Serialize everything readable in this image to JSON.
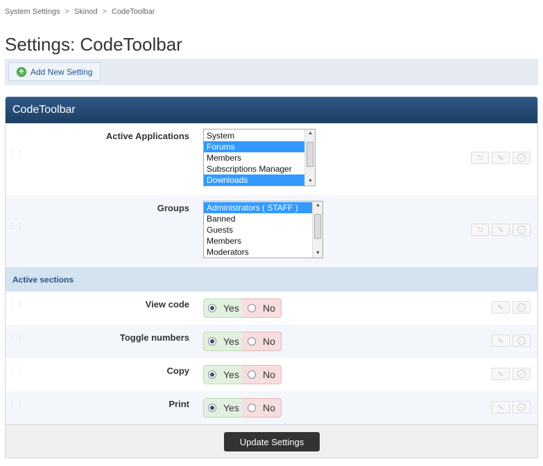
{
  "breadcrumb": {
    "items": [
      "System Settings",
      "Skinod",
      "CodeToolbar"
    ],
    "separator": ">"
  },
  "page": {
    "title": "Settings: CodeToolbar"
  },
  "toolbar": {
    "add_label": "Add New Setting"
  },
  "panel": {
    "title": "CodeToolbar",
    "active_applications": {
      "label": "Active Applications",
      "options": [
        "System",
        "Forums",
        "Members",
        "Subscriptions Manager",
        "Downloads"
      ],
      "selected": [
        "Forums",
        "Downloads"
      ]
    },
    "groups": {
      "label": "Groups",
      "options": [
        "Administrators ( STAFF )",
        "Banned",
        "Guests",
        "Members",
        "Moderators"
      ],
      "selected": [
        "Administrators ( STAFF )"
      ]
    },
    "section_title": "Active sections",
    "toggles": [
      {
        "label": "View code",
        "yes": "Yes",
        "no": "No",
        "value": "Yes"
      },
      {
        "label": "Toggle numbers",
        "yes": "Yes",
        "no": "No",
        "value": "Yes"
      },
      {
        "label": "Copy",
        "yes": "Yes",
        "no": "No",
        "value": "Yes"
      },
      {
        "label": "Print",
        "yes": "Yes",
        "no": "No",
        "value": "Yes"
      }
    ],
    "submit_label": "Update Settings"
  },
  "colors": {
    "header_bg": "#1d3e63",
    "section_bg": "#d5e2ef",
    "yes_bg": "#e2f1df",
    "no_bg": "#f7dede",
    "selection": "#3399ff"
  }
}
